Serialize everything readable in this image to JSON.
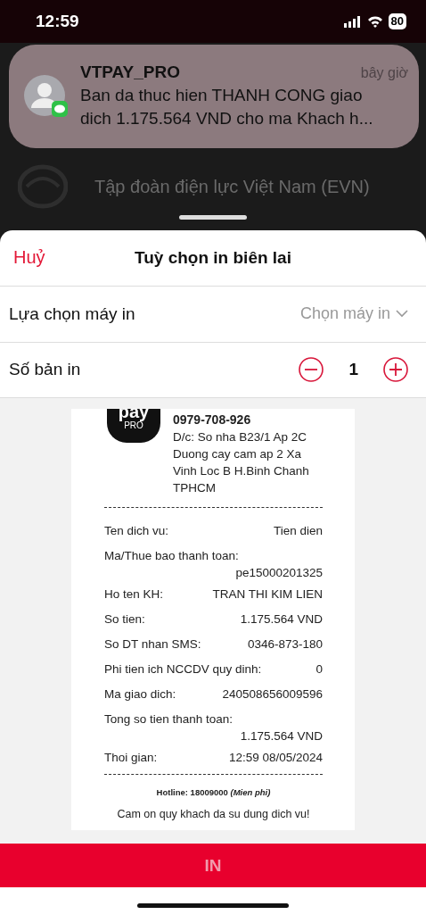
{
  "status_bar": {
    "time": "12:59",
    "battery": "80"
  },
  "notification": {
    "app": "VTPAY_PRO",
    "time": "bây giờ",
    "message": "Ban da thuc hien THANH CONG giao dich 1.175.564 VND cho ma Khach h..."
  },
  "background": {
    "provider": "Tập đoàn điện lực Việt Nam (EVN)"
  },
  "sheet": {
    "cancel": "Huỷ",
    "title": "Tuỳ chọn in biên lai"
  },
  "printer": {
    "label": "Lựa chọn máy in",
    "placeholder": "Chọn máy in"
  },
  "copies": {
    "label": "Số bản in",
    "count": "1"
  },
  "receipt": {
    "logo_top": "pay",
    "logo_badge": "PRO",
    "phone": "0979-708-926",
    "address": "D/c: So nha B23/1 Ap 2C Duong cay cam ap 2 Xa Vinh Loc B H.Binh Chanh TPHCM",
    "fields": [
      {
        "kind": "inline",
        "label": "Ten dich vu:",
        "value": "Tien dien"
      },
      {
        "kind": "stacked",
        "label": "Ma/Thue bao thanh toan:",
        "value": "pe15000201325"
      },
      {
        "kind": "inline",
        "label": "Ho ten KH:",
        "value": "TRAN THI KIM LIEN"
      },
      {
        "kind": "inline",
        "label": "So tien:",
        "value": "1.175.564 VND"
      },
      {
        "kind": "inline",
        "label": "So DT nhan SMS:",
        "value": "0346-873-180"
      },
      {
        "kind": "inline",
        "label": "Phi tien ich NCCDV quy dinh:",
        "value": "0"
      },
      {
        "kind": "inline",
        "label": "Ma giao dich:",
        "value": "240508656009596"
      },
      {
        "kind": "stacked",
        "label": "Tong so tien thanh toan:",
        "value": "1.175.564 VND"
      },
      {
        "kind": "inline",
        "label": "Thoi gian:",
        "value": "12:59 08/05/2024"
      }
    ],
    "hotline": "Hotline: 18009000 *(Mien phi)*",
    "thanks": "Cam on quy khach da su dung dich vu!"
  },
  "print_button": {
    "label": "IN",
    "disabled": true
  }
}
